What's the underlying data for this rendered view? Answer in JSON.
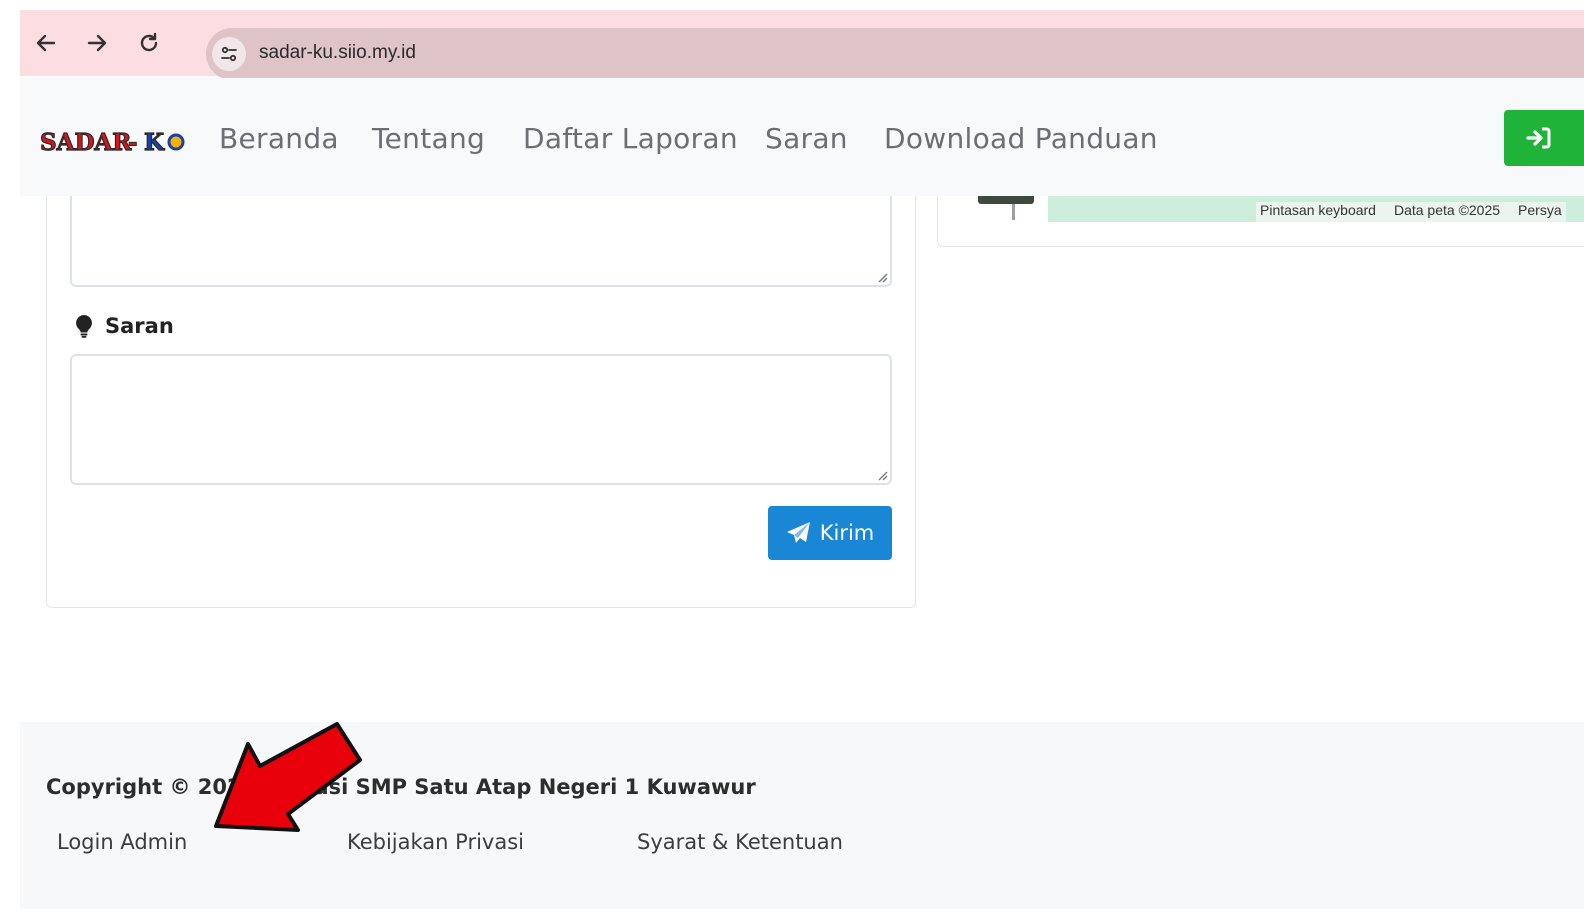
{
  "browser": {
    "url": "sadar-ku.siio.my.id"
  },
  "header": {
    "logo_text": "SADAR-KU",
    "nav": [
      {
        "label": "Beranda"
      },
      {
        "label": "Tentang"
      },
      {
        "label": "Daftar Laporan"
      },
      {
        "label": "Saran"
      },
      {
        "label": "Download Panduan"
      }
    ],
    "login_color": "#20b33a"
  },
  "form": {
    "saran_label": "Saran",
    "saran_icon": "lightbulb-icon",
    "submit_label": "Kirim",
    "submit_icon": "paper-plane-icon",
    "submit_color": "#1a87d6"
  },
  "map": {
    "credits": [
      "Pintasan keyboard",
      "Data peta ©2025",
      "Persya"
    ]
  },
  "footer": {
    "copyright": "Copyright © 2024 Inovasi SMP Satu Atap Negeri 1 Kuwawur",
    "links": [
      {
        "label": "Login Admin"
      },
      {
        "label": "Kebijakan Privasi"
      },
      {
        "label": "Syarat & Ketentuan"
      }
    ]
  },
  "annotation": {
    "arrow_color": "#e8000b"
  }
}
